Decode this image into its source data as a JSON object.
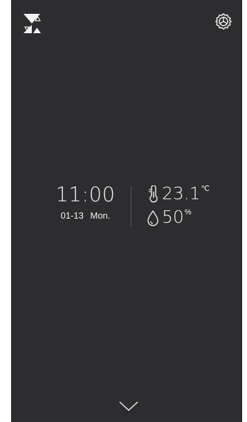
{
  "icons": {
    "logo": "fan-logo-icon",
    "settings": "gear-icon",
    "temperature": "thermometer-icon",
    "humidity": "water-drop-icon",
    "expand": "chevron-down-icon"
  },
  "clock": {
    "time": "11:00",
    "date": "01-13",
    "weekday": "Mon."
  },
  "climate": {
    "temperature": "23.1",
    "temperature_unit": "℃",
    "humidity": "50",
    "humidity_unit": "%"
  },
  "colors": {
    "background": "#2d2d2f",
    "text": "#f2f2f2"
  }
}
